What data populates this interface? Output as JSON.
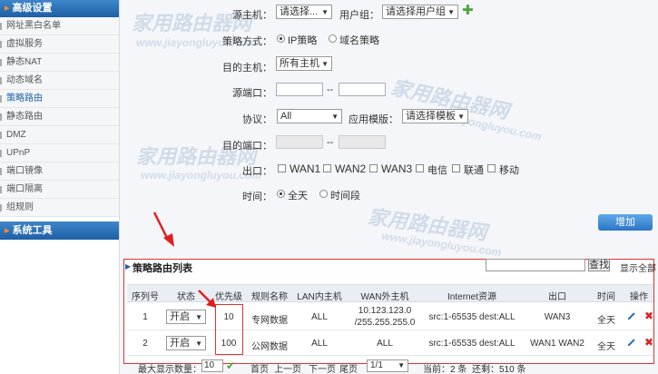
{
  "sidebar": {
    "advanced_title": "高级设置",
    "items": [
      {
        "label": "网址黑白名单"
      },
      {
        "label": "虚拟服务"
      },
      {
        "label": "静态NAT"
      },
      {
        "label": "动态域名"
      },
      {
        "label": "策略路由"
      },
      {
        "label": "静态路由"
      },
      {
        "label": "DMZ"
      },
      {
        "label": "UPnP"
      },
      {
        "label": "端口镜像"
      },
      {
        "label": "端口隔离"
      },
      {
        "label": "组规则"
      }
    ],
    "tools_title": "系统工具"
  },
  "form": {
    "src_host_label": "源主机：",
    "src_host_value": "请选择...",
    "user_group_label": "用户组：",
    "user_group_value": "请选择用户组",
    "policy_mode_label": "策略方式：",
    "policy_ip": "IP策略",
    "policy_domain": "域名策略",
    "dst_host_label": "目的主机：",
    "dst_host_value": "所有主机",
    "src_port_label": "源端口：",
    "protocol_label": "协议：",
    "protocol_value": "All",
    "app_template_label": "应用模版：",
    "app_template_value": "请选择模板",
    "dst_port_label": "目的端口：",
    "range_sep": "--",
    "exit_label": "出口：",
    "exits": [
      "WAN1",
      "WAN2",
      "WAN3",
      "电信",
      "联通",
      "移动"
    ],
    "time_label": "时间：",
    "time_all": "全天",
    "time_range": "时间段",
    "add_button": "增加"
  },
  "list": {
    "title": "策略路由列表",
    "search_button": "查找",
    "show_all": "显示全部",
    "columns": [
      "序列号",
      "状态",
      "优先级",
      "规则名称",
      "LAN内主机",
      "WAN外主机",
      "Internet资源",
      "出口",
      "时间",
      "操作"
    ],
    "rows": [
      {
        "seq": "1",
        "status": "开启",
        "priority": "10",
        "name": "专网数据",
        "lan": "ALL",
        "wan_line1": "10.123.123.0",
        "wan_line2": "/255.255.255.0",
        "internet": "src:1-65535 dest:ALL",
        "exit": "WAN3",
        "time": "全天"
      },
      {
        "seq": "2",
        "status": "开启",
        "priority": "100",
        "name": "公网数据",
        "lan": "ALL",
        "wan_line1": "ALL",
        "wan_line2": "",
        "internet": "src:1-65535 dest:ALL",
        "exit": "WAN1 WAN2",
        "time": "全天"
      }
    ]
  },
  "footer": {
    "max_display_label": "最大显示数量：",
    "max_display_value": "10",
    "first": "首页",
    "prev": "上一页",
    "next": "下一页",
    "last": "尾页",
    "page_value": "1/1",
    "current": "当前：2 条",
    "remaining": "还剩：510 条"
  },
  "watermark": {
    "cn": "家用路由器网",
    "en": "www.jiayongluyou.com"
  },
  "colors": {
    "accent": "#2a76c4",
    "highlight": "#dd3333",
    "add_icon": "#4aa83a"
  }
}
